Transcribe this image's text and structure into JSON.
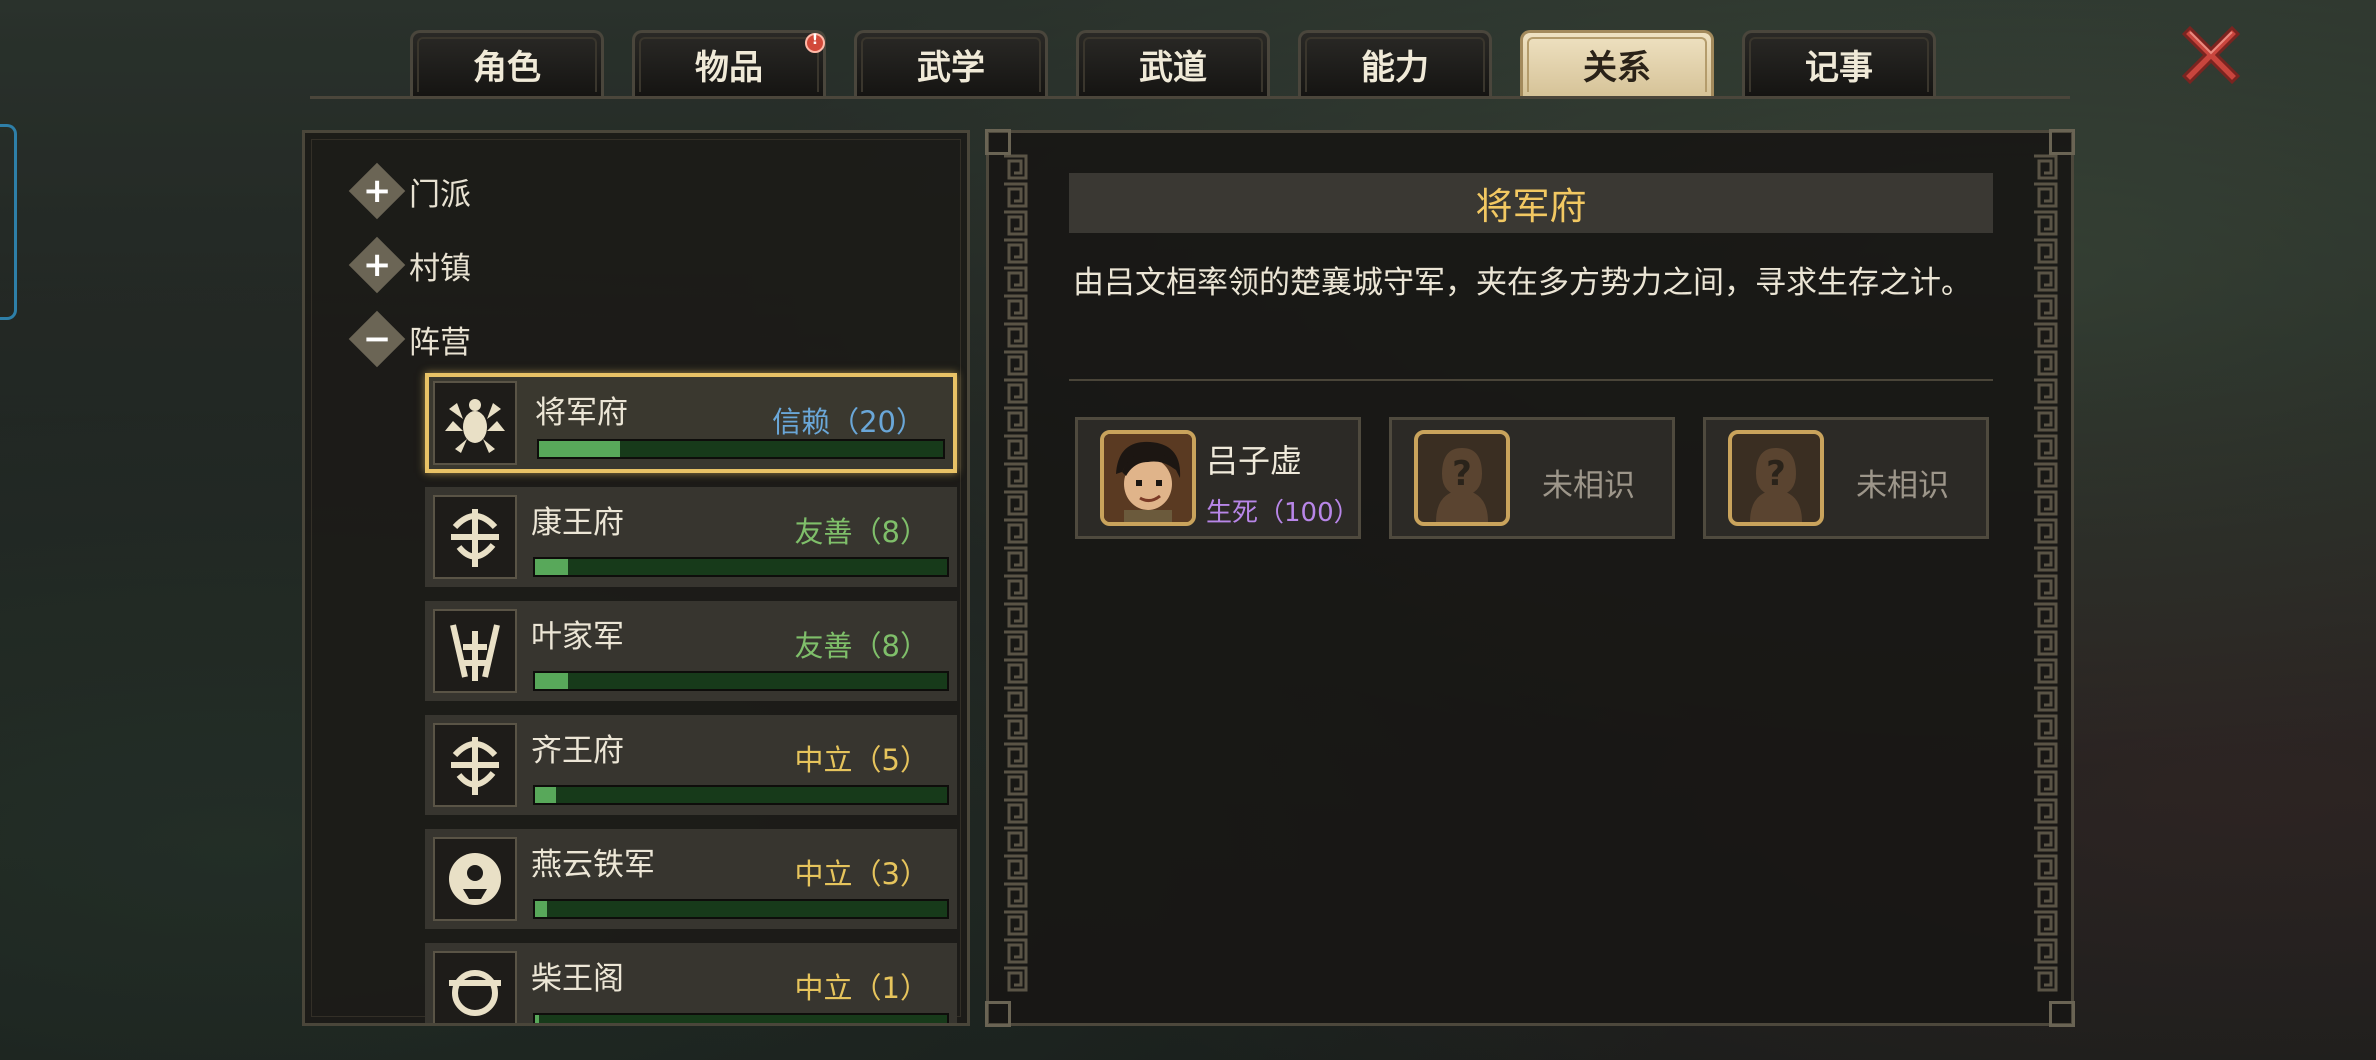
{
  "tabs": [
    {
      "label": "角色",
      "active": false,
      "badge": false
    },
    {
      "label": "物品",
      "active": false,
      "badge": true
    },
    {
      "label": "武学",
      "active": false,
      "badge": false
    },
    {
      "label": "武道",
      "active": false,
      "badge": false
    },
    {
      "label": "能力",
      "active": false,
      "badge": false
    },
    {
      "label": "关系",
      "active": true,
      "badge": false
    },
    {
      "label": "记事",
      "active": false,
      "badge": false
    }
  ],
  "categories": [
    {
      "label": "门派",
      "toggle": "+"
    },
    {
      "label": "村镇",
      "toggle": "+"
    },
    {
      "label": "阵营",
      "toggle": "−"
    }
  ],
  "factions": [
    {
      "name": "将军府",
      "status": "信赖（20）",
      "status_color": "#6aa7d8",
      "progress": 0.2,
      "selected": true
    },
    {
      "name": "康王府",
      "status": "友善（8）",
      "status_color": "#7fbf6a",
      "progress": 0.08,
      "selected": false
    },
    {
      "name": "叶家军",
      "status": "友善（8）",
      "status_color": "#7fbf6a",
      "progress": 0.08,
      "selected": false
    },
    {
      "name": "齐王府",
      "status": "中立（5）",
      "status_color": "#e6c45c",
      "progress": 0.05,
      "selected": false
    },
    {
      "name": "燕云铁军",
      "status": "中立（3）",
      "status_color": "#e6c45c",
      "progress": 0.03,
      "selected": false
    },
    {
      "name": "柴王阁",
      "status": "中立（1）",
      "status_color": "#e6c45c",
      "progress": 0.01,
      "selected": false
    }
  ],
  "detail": {
    "title": "将军府",
    "description": "由吕文桓率领的楚襄城守军，夹在多方势力之间，寻求生存之计。"
  },
  "characters": [
    {
      "name": "吕子虚",
      "relation": "生死（100）",
      "known": true
    },
    {
      "name": "",
      "relation": "",
      "known": false,
      "unknown_label": "未相识",
      "qmark": "?"
    },
    {
      "name": "",
      "relation": "",
      "known": false,
      "unknown_label": "未相识",
      "qmark": "?"
    }
  ]
}
